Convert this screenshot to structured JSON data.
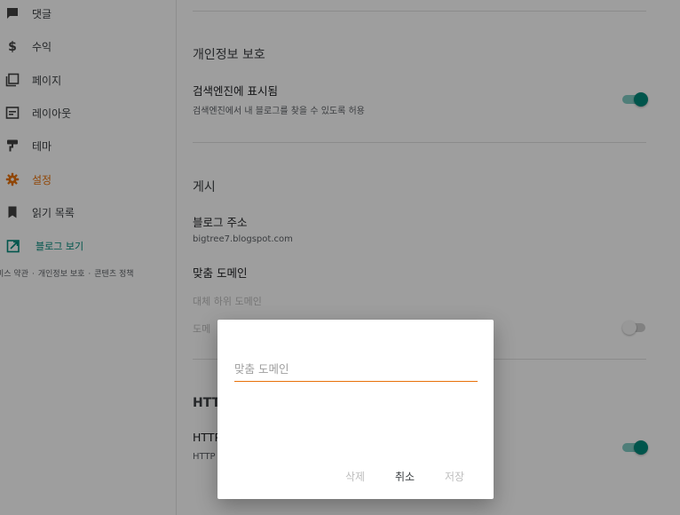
{
  "sidebar": {
    "items": [
      {
        "label": "댓글",
        "icon": "comment-icon"
      },
      {
        "label": "수익",
        "icon": "dollar-icon"
      },
      {
        "label": "페이지",
        "icon": "pages-icon"
      },
      {
        "label": "레이아웃",
        "icon": "layout-icon"
      },
      {
        "label": "테마",
        "icon": "paint-roller-icon"
      },
      {
        "label": "설정",
        "icon": "gear-icon"
      },
      {
        "label": "읽기 목록",
        "icon": "bookmark-icon"
      }
    ],
    "view_blog": "블로그 보기",
    "footer": [
      "비스 약관",
      "개인정보 보호",
      "콘텐츠 정책"
    ]
  },
  "colors": {
    "accent_orange": "#e8710a",
    "teal": "#00897b",
    "teal_light": "#80cbc4"
  },
  "privacy": {
    "title": "개인정보 보호",
    "search_visible_title": "검색엔진에 표시됨",
    "search_visible_sub": "검색엔진에서 내 블로그를 찾을 수 있도록 허용"
  },
  "publish": {
    "title": "게시",
    "blog_address_title": "블로그 주소",
    "blog_address_value": "bigtree7.blogspot.com",
    "custom_domain_title": "맞춤 도메인",
    "fallback_domain": "대체 하위 도메인",
    "domain_redirect": "도메"
  },
  "https": {
    "title": "HTT",
    "availability": "HTTP",
    "availability_sub": "HTTP"
  },
  "dialog": {
    "placeholder": "맞춤 도메인",
    "delete": "삭제",
    "cancel": "취소",
    "save": "저장"
  }
}
